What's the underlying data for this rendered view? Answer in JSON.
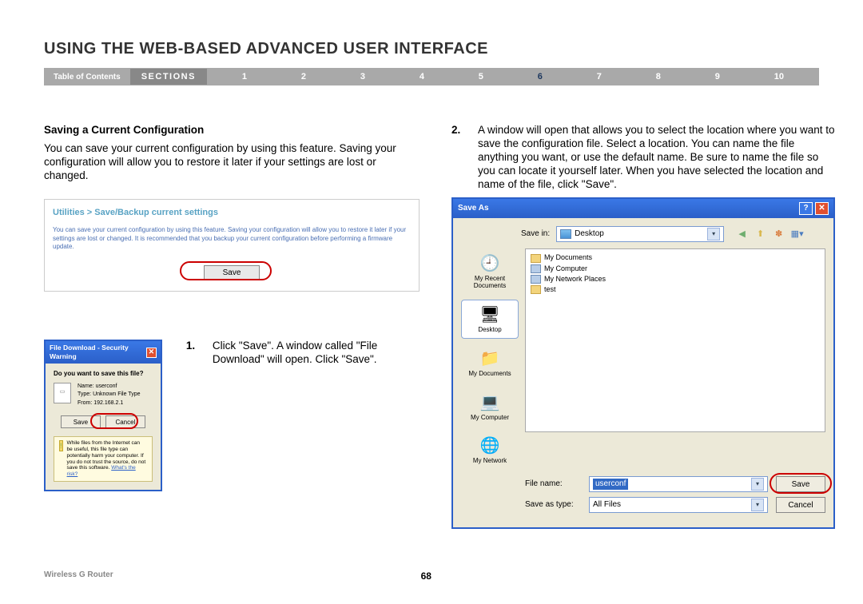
{
  "page_title": "USING THE WEB-BASED ADVANCED USER INTERFACE",
  "nav": {
    "toc": "Table of Contents",
    "sections_label": "SECTIONS",
    "nums": [
      "1",
      "2",
      "3",
      "4",
      "5",
      "6",
      "7",
      "8",
      "9",
      "10"
    ],
    "active": "6"
  },
  "left": {
    "heading": "Saving a Current Configuration",
    "para": "You can save your current configuration by using this feature. Saving your configuration will allow you to restore it later if your settings are lost or changed.",
    "util": {
      "breadcrumb": "Utilities > Save/Backup current settings",
      "blurb": "You can save your current configuration by using this feature. Saving your configuration will allow you to restore it later if your settings are lost or changed. It is recommended that you backup your current configuration before performing a firmware update.",
      "save_btn": "Save"
    },
    "step1": {
      "num": "1.",
      "text": "Click \"Save\". A window called \"File Download\" will open. Click \"Save\"."
    },
    "dlg": {
      "title": "File Download - Security Warning",
      "question": "Do you want to save this file?",
      "name_lbl": "Name:",
      "name_val": "userconf",
      "type_lbl": "Type:",
      "type_val": "Unknown File Type",
      "from_lbl": "From:",
      "from_val": "192.168.2.1",
      "save_btn": "Save",
      "cancel_btn": "Cancel",
      "warn": "While files from the Internet can be useful, this file type can potentially harm your computer. If you do not trust the source, do not save this software.",
      "warn_link": "What's the risk?"
    }
  },
  "right": {
    "step2": {
      "num": "2.",
      "text": "A window will open that allows you to select the location where you want to save the configuration file. Select a location. You can name the file anything you want, or use the default name. Be sure to name the file so you can locate it yourself later. When you have selected the location and name of the file, click \"Save\"."
    },
    "dlg": {
      "title": "Save As",
      "savein_lbl": "Save in:",
      "savein_val": "Desktop",
      "side": [
        "My Recent Documents",
        "Desktop",
        "My Documents",
        "My Computer",
        "My Network"
      ],
      "items": [
        "My Documents",
        "My Computer",
        "My Network Places",
        "test"
      ],
      "filename_lbl": "File name:",
      "filename_val": "userconf",
      "savetype_lbl": "Save as type:",
      "savetype_val": "All Files",
      "save_btn": "Save",
      "cancel_btn": "Cancel"
    }
  },
  "footer": {
    "left": "Wireless G Router",
    "page": "68"
  }
}
